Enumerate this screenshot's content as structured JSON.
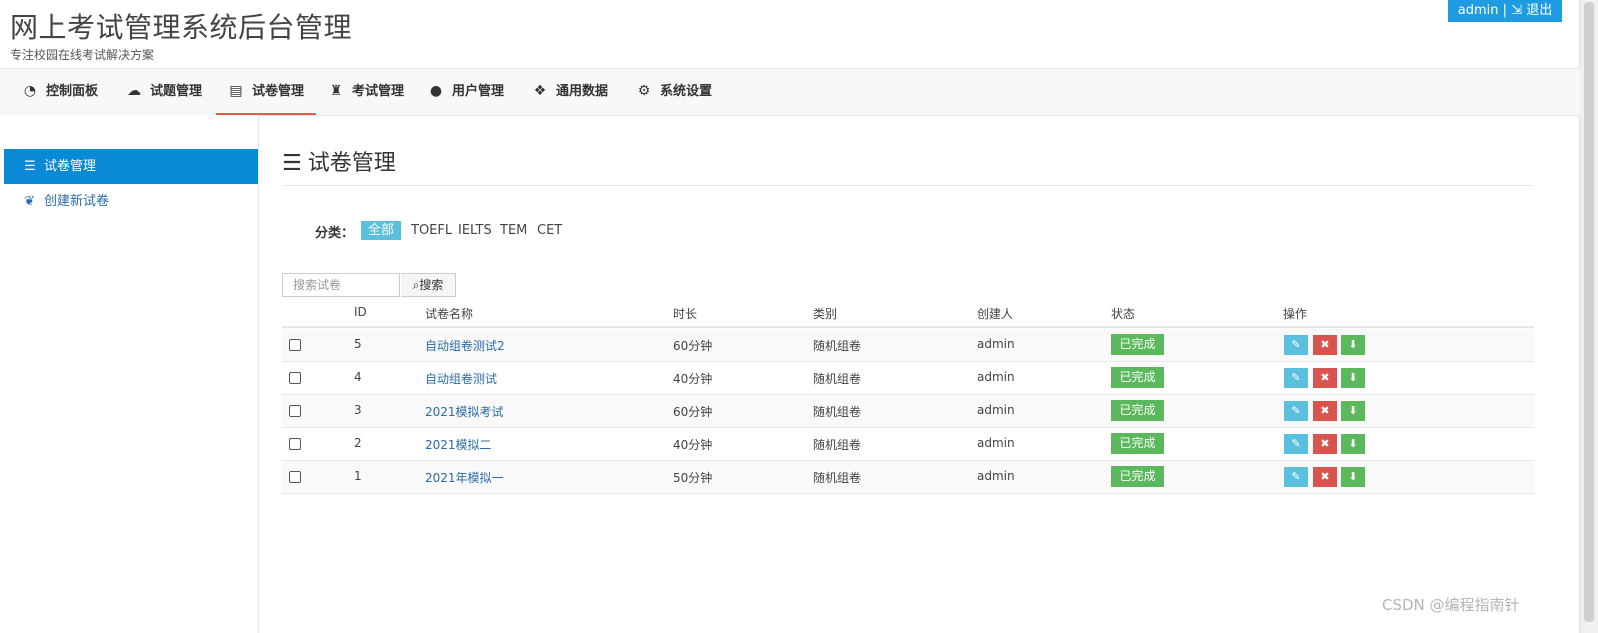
{
  "header": {
    "title": "网上考试管理系统后台管理",
    "subtitle": "专注校园在线考试解决方案",
    "user": "admin",
    "separator": "|",
    "logout": "退出"
  },
  "nav": [
    {
      "label": "控制面板",
      "icon": "dashboard-icon"
    },
    {
      "label": "试题管理",
      "icon": "cloud-icon"
    },
    {
      "label": "试卷管理",
      "icon": "file-text-icon"
    },
    {
      "label": "考试管理",
      "icon": "trophy-icon"
    },
    {
      "label": "用户管理",
      "icon": "user-icon"
    },
    {
      "label": "通用数据",
      "icon": "cubes-icon"
    },
    {
      "label": "系统设置",
      "icon": "gear-icon"
    }
  ],
  "sidebar": {
    "items": [
      {
        "label": "试卷管理",
        "icon": "list-icon"
      },
      {
        "label": "创建新试卷",
        "icon": "leaf-icon"
      }
    ]
  },
  "main": {
    "title": "试卷管理",
    "category_label": "分类：",
    "categories": [
      "全部",
      "TOEFL",
      "IELTS",
      "TEM",
      "CET"
    ],
    "search_placeholder": "搜索试卷",
    "search_button": "搜索"
  },
  "table": {
    "columns": [
      "ID",
      "试卷名称",
      "时长",
      "类别",
      "创建人",
      "状态",
      "操作"
    ],
    "rows": [
      {
        "id": "5",
        "name": "自动组卷测试2",
        "duration": "60分钟",
        "type": "随机组卷",
        "creator": "admin",
        "status": "已完成"
      },
      {
        "id": "4",
        "name": "自动组卷测试",
        "duration": "40分钟",
        "type": "随机组卷",
        "creator": "admin",
        "status": "已完成"
      },
      {
        "id": "3",
        "name": "2021模拟考试",
        "duration": "60分钟",
        "type": "随机组卷",
        "creator": "admin",
        "status": "已完成"
      },
      {
        "id": "2",
        "name": "2021模拟二",
        "duration": "40分钟",
        "type": "随机组卷",
        "creator": "admin",
        "status": "已完成"
      },
      {
        "id": "1",
        "name": "2021年模拟一",
        "duration": "50分钟",
        "type": "随机组卷",
        "creator": "admin",
        "status": "已完成"
      }
    ]
  },
  "watermark": "CSDN @编程指南针",
  "colors": {
    "primary": "#0a8ad6",
    "header_button": "#1e9be1",
    "success": "#5cb85c",
    "info": "#5bc0de",
    "danger": "#d9534f",
    "active_tab_underline": "#e05c4a"
  }
}
